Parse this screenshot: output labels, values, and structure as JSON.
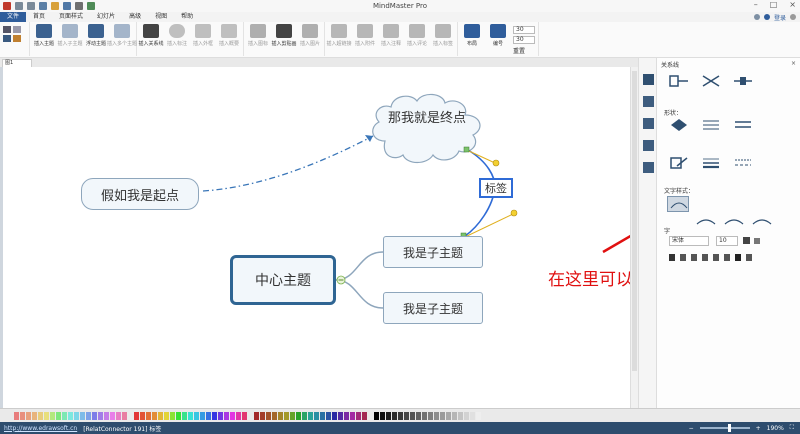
{
  "app_title": "MindMaster Pro",
  "menu": [
    "文件",
    "首页",
    "页面样式",
    "幻灯片",
    "高级",
    "视图",
    "帮助"
  ],
  "menu_right": {
    "login": "登录"
  },
  "ribbon": {
    "insert_buttons": [
      {
        "label": "插入主题",
        "disabled": false
      },
      {
        "label": "插入子主题",
        "disabled": true
      },
      {
        "label": "浮动主题",
        "disabled": false
      },
      {
        "label": "插入多个主题",
        "disabled": true
      }
    ],
    "relation_buttons": [
      {
        "label": "插入关系线",
        "disabled": false
      },
      {
        "label": "插入标注",
        "disabled": true
      },
      {
        "label": "插入外框",
        "disabled": true
      },
      {
        "label": "插入概要",
        "disabled": true
      }
    ],
    "clip_buttons": [
      {
        "label": "插入图标",
        "disabled": true
      },
      {
        "label": "插入剪贴画",
        "disabled": false
      },
      {
        "label": "插入图片",
        "disabled": true
      }
    ],
    "link_buttons": [
      {
        "label": "插入超链接",
        "disabled": true
      },
      {
        "label": "插入附件",
        "disabled": true
      },
      {
        "label": "插入注释",
        "disabled": true
      },
      {
        "label": "插入评论",
        "disabled": true
      },
      {
        "label": "插入标签",
        "disabled": true
      }
    ],
    "layout_buttons": [
      {
        "label": "布局",
        "disabled": false
      },
      {
        "label": "编号",
        "disabled": false
      }
    ],
    "spin1": "30",
    "spin2": "30",
    "reset_label": "重置"
  },
  "tab": {
    "label": "图1"
  },
  "mindmap": {
    "start": "假如我是起点",
    "end": "那我就是终点",
    "central": "中心主题",
    "child1": "我是子主题",
    "child2": "我是子主题",
    "label": "标签"
  },
  "annotation": "在这里可以修改标签样式",
  "panel": {
    "title": "关系线",
    "close": "×",
    "shape_label": "形状：",
    "text_style_label": "文字样式：",
    "font_label": "字",
    "font_name": "宋体",
    "font_size": "10"
  },
  "status": {
    "link": "http://www.edrawsoft.cn",
    "info": "[RelatConnector 191]  标签",
    "zoom": "190%"
  },
  "colors": {
    "accent": "#2f5d9b",
    "node_border": "#8ea6bc",
    "central_border": "#2f6593",
    "relation_line": "#3a76b8",
    "label_border": "#2f6bd6",
    "annotation": "#e01010"
  }
}
